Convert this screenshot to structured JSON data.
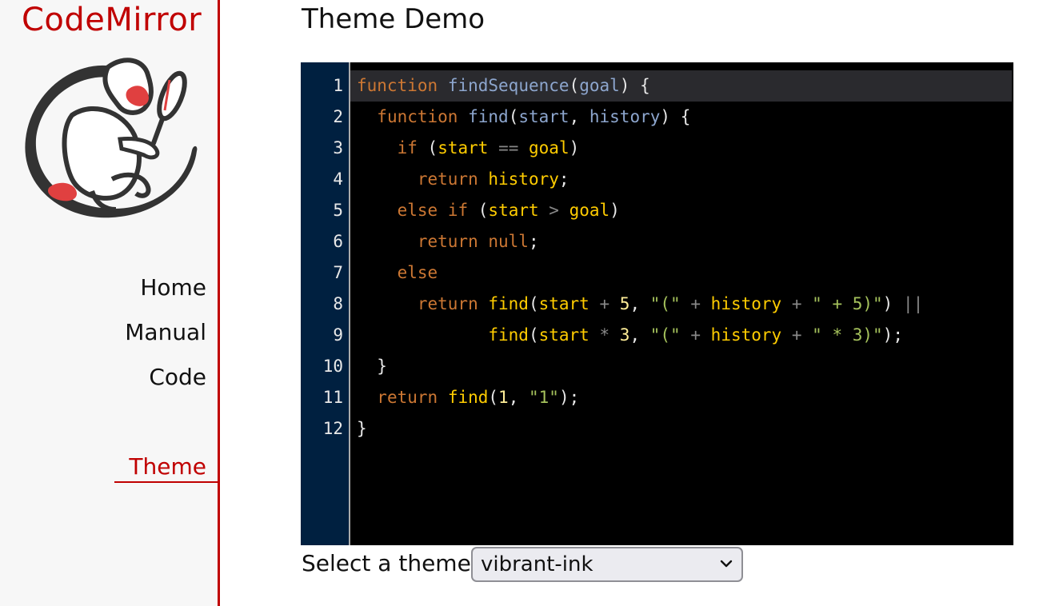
{
  "sidebar": {
    "logo_text": "CodeMirror",
    "logo_icon": "codemirror-monkey-logo",
    "nav": [
      {
        "label": "Home"
      },
      {
        "label": "Manual"
      },
      {
        "label": "Code"
      },
      {
        "label": "Theme",
        "active": true
      }
    ],
    "accent_color": "#c00000"
  },
  "main": {
    "title": "Theme Demo",
    "editor": {
      "theme": "vibrant-ink",
      "active_line": 1,
      "line_numbers": [
        "1",
        "2",
        "3",
        "4",
        "5",
        "6",
        "7",
        "8",
        "9",
        "10",
        "11",
        "12"
      ],
      "lines": [
        "function findSequence(goal) {",
        "  function find(start, history) {",
        "    if (start == goal)",
        "      return history;",
        "    else if (start > goal)",
        "      return null;",
        "    else",
        "      return find(start + 5, \"(\" + history + \" + 5)\") ||",
        "             find(start * 3, \"(\" + history + \" * 3)\");",
        "  }",
        "  return find(1, \"1\");",
        "}"
      ],
      "colors": {
        "background": "#000000",
        "gutter": "#002040",
        "keyword": "#cc7733",
        "string": "#a5c25c",
        "number": "#ffee98",
        "variable": "#ffcc00",
        "definition": "#8da6ce"
      }
    },
    "theme_selector": {
      "label": "Select a theme:",
      "selected": "vibrant-ink",
      "chevron_icon": "chevron-down-icon"
    }
  }
}
